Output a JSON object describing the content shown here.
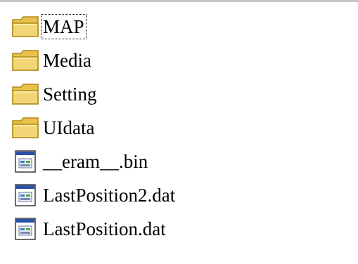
{
  "colors": {
    "folder_fill": "#f2d676",
    "folder_edge": "#b08a1a",
    "file_fill": "#ffffff",
    "file_edge": "#3a3a3a",
    "file_titlebar": "#2b50a8"
  },
  "files": [
    {
      "name": "MAP",
      "icon": "folder-icon",
      "focused": true
    },
    {
      "name": "Media",
      "icon": "folder-icon",
      "focused": false
    },
    {
      "name": "Setting",
      "icon": "folder-icon",
      "focused": false
    },
    {
      "name": "UIdata",
      "icon": "folder-icon",
      "focused": false
    },
    {
      "name": "__eram__.bin",
      "icon": "application-file-icon",
      "focused": false
    },
    {
      "name": "LastPosition2.dat",
      "icon": "application-file-icon",
      "focused": false
    },
    {
      "name": "LastPosition.dat",
      "icon": "application-file-icon",
      "focused": false
    }
  ]
}
